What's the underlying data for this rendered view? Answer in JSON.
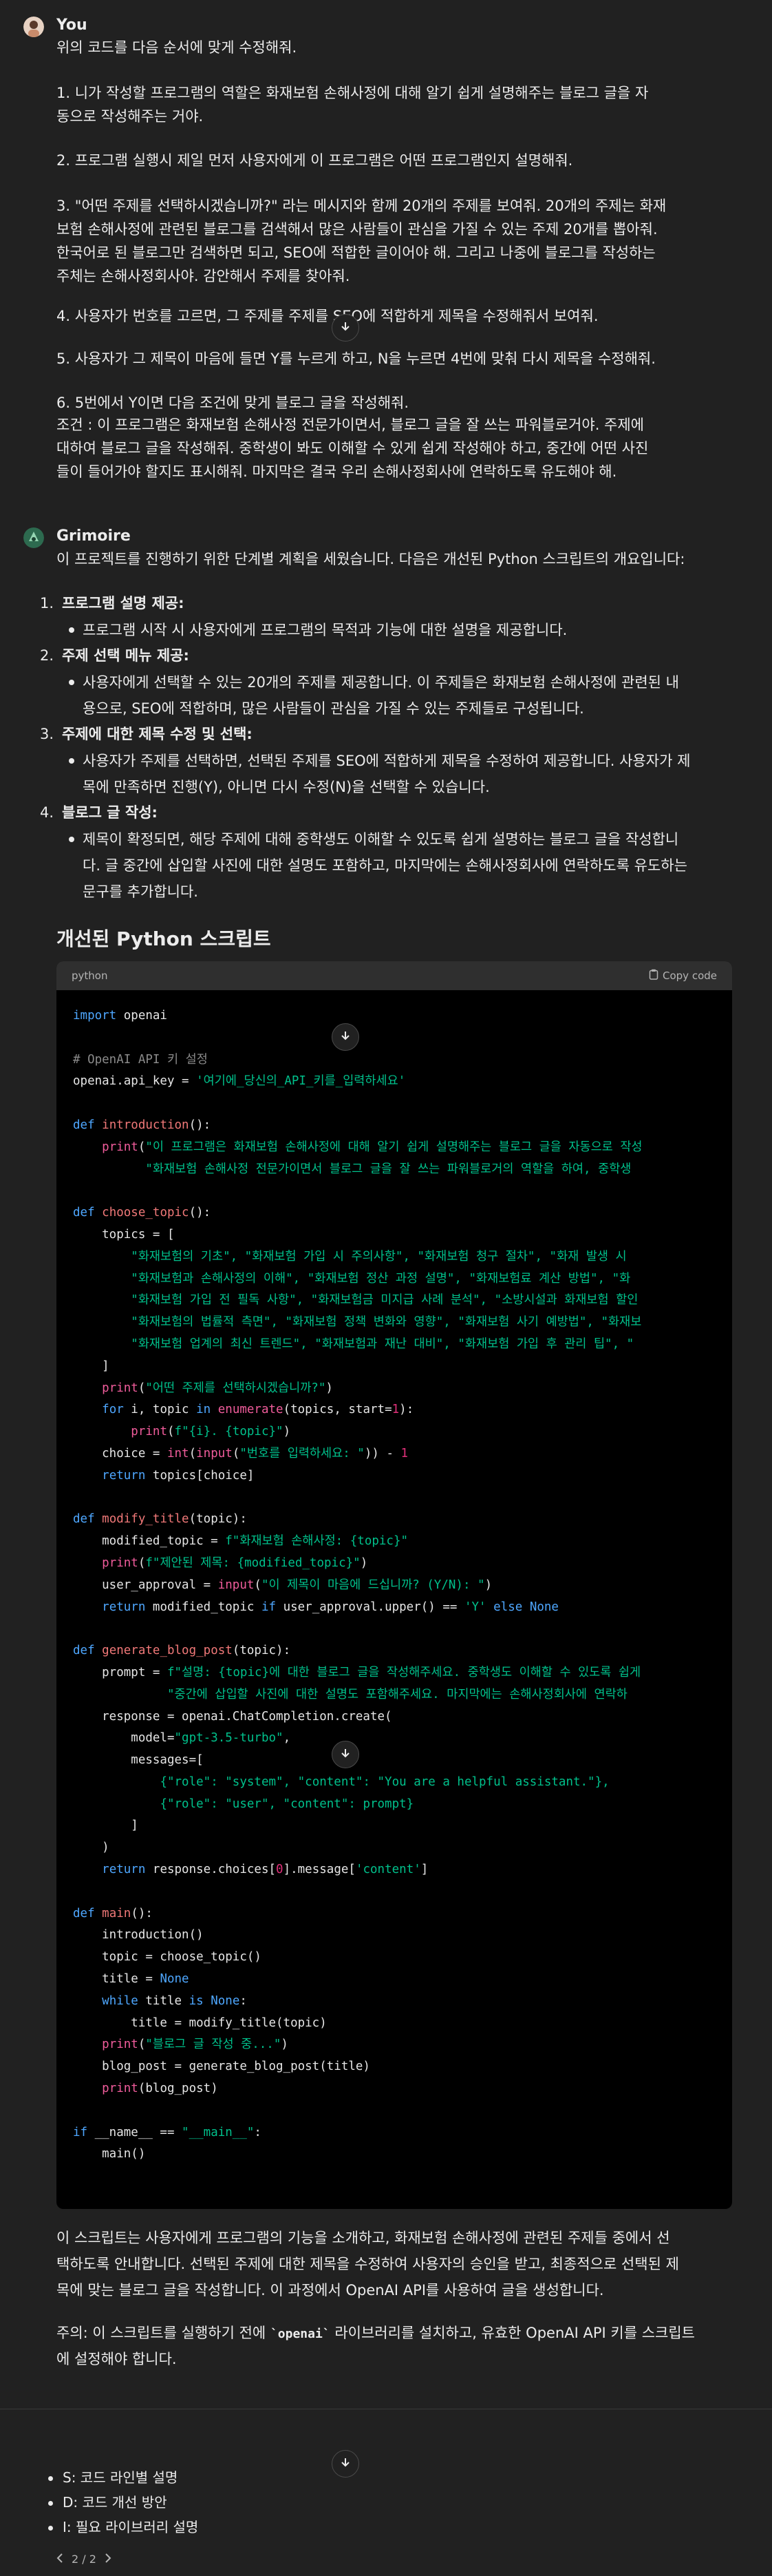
{
  "user": {
    "name": "You",
    "lines": [
      "위의 코드를 다음 순서에 맞게 수정해줘.",
      "1. 니가 작성할 프로그램의 역할은 화재보험 손해사정에 대해 알기 쉽게 설명해주는 블로그 글을 자",
      "동으로 작성해주는 거야.",
      "2. 프로그램 실행시 제일 먼저 사용자에게 이 프로그램은 어떤 프로그램인지 설명해줘.",
      "3. \"어떤 주제를 선택하시겠습니까?\" 라는 메시지와 함께 20개의 주제를 보여줘. 20개의 주제는 화재",
      "보험 손해사정에 관련된 블로그를 검색해서 많은 사람들이 관심을 가질 수 있는 주제 20개를 뽑아줘.",
      "한국어로 된 블로그만 검색하면 되고, SEO에 적합한 글이어야 해. 그리고 나중에 블로그를 작성하는",
      "주체는 손해사정회사야. 감안해서 주제를 찾아줘.",
      "4. 사용자가 번호를 고르면, 그 주제를 주제를 SEO에 적합하게 제목을 수정해줘서 보여줘.",
      "5. 사용자가 그 제목이 마음에 들면 Y를 누르게 하고, N을 누르면 4번에 맞춰 다시 제목을 수정해줘.",
      "6. 5번에서 Y이면 다음 조건에 맞게 블로그 글을 작성해줘.",
      "조건 : 이 프로그램은 화재보험 손해사정 전문가이면서, 블로그 글을 잘 쓰는 파워블로거야. 주제에",
      "대하여 블로그 글을 작성해줘. 중학생이 봐도 이해할 수 있게 쉽게 작성해야 하고, 중간에 어떤 사진",
      "들이 들어가야 할지도 표시해줘. 마지막은 결국 우리 손해사정회사에 연락하도록 유도해야 해."
    ]
  },
  "assistant": {
    "name": "Grimoire",
    "intro": "이 프로젝트를 진행하기 위한 단계별 계획을 세웠습니다. 다음은 개선된 Python 스크립트의 개요입니다:",
    "steps": [
      {
        "num": "1.",
        "title": "프로그램 설명 제공:",
        "lines": [
          "프로그램 시작 시 사용자에게 프로그램의 목적과 기능에 대한 설명을 제공합니다."
        ]
      },
      {
        "num": "2.",
        "title": "주제 선택 메뉴 제공:",
        "lines": [
          "사용자에게 선택할 수 있는 20개의 주제를 제공합니다. 이 주제들은 화재보험 손해사정에 관련된 내",
          "용으로, SEO에 적합하며, 많은 사람들이 관심을 가질 수 있는 주제들로 구성됩니다."
        ]
      },
      {
        "num": "3.",
        "title": "주제에 대한 제목 수정 및 선택:",
        "lines": [
          "사용자가 주제를 선택하면, 선택된 주제를 SEO에 적합하게 제목을 수정하여 제공합니다. 사용자가 제",
          "목에 만족하면 진행(Y), 아니면 다시 수정(N)을 선택할 수 있습니다."
        ]
      },
      {
        "num": "4.",
        "title": "블로그 글 작성:",
        "lines": [
          "제목이 확정되면, 해당 주제에 대해 중학생도 이해할 수 있도록 쉽게 설명하는 블로그 글을 작성합니",
          "다. 글 중간에 삽입할 사진에 대한 설명도 포함하고, 마지막에는 손해사정회사에 연락하도록 유도하는",
          "문구를 추가합니다."
        ]
      }
    ],
    "heading": "개선된 Python 스크립트",
    "code": {
      "language": "python",
      "copy_label": "Copy code",
      "line_texts": {
        "key_line": "openai.api_key = '여기에_당신의_API_키를_입력하세요'",
        "comment": "# OpenAI API 키 설정",
        "intro_print1": "\"이 프로그램은 화재보험 손해사정에 대해 알기 쉽게 설명해주는 블로그 글을 자동으로 작성",
        "intro_print2": "\"화재보험 손해사정 전문가이면서 블로그 글을 잘 쓰는 파워블로거의 역할을 하여, 중학생",
        "topics1": "\"화재보험의 기초\", \"화재보험 가입 시 주의사항\", \"화재보험 청구 절차\", \"화재 발생 시",
        "topics2": "\"화재보험과 손해사정의 이해\", \"화재보험 정산 과정 설명\", \"화재보험료 계산 방법\", \"화",
        "topics3": "\"화재보험 가입 전 필독 사항\", \"화재보험금 미지급 사례 분석\", \"소방시설과 화재보험 할인",
        "topics4": "\"화재보험의 법률적 측면\", \"화재보험 정책 변화와 영향\", \"화재보험 사기 예방법\", \"화재보",
        "topics5": "\"화재보험 업계의 최신 트렌드\", \"화재보험과 재난 대비\", \"화재보험 가입 후 관리 팁\", \"",
        "choose_print": "\"어떤 주제를 선택하시겠습니까?\"",
        "fstr_topic": "f\"{i}. {topic}\"",
        "input_num": "\"번호를 입력하세요: \"",
        "mod_topic": "f\"화재보험 손해사정: {topic}\"",
        "mod_print": "f\"제안된 제목: {modified_topic}\"",
        "approval": "\"이 제목이 마음에 드십니까? (Y/N): \"",
        "prompt1": "f\"설명: {topic}에 대한 블로그 글을 작성해주세요. 중학생도 이해할 수 있도록 쉽게",
        "prompt2": "\"중간에 삽입할 사진에 대한 설명도 포함해주세요. 마지막에는 손해사정회사에 연락하",
        "model": "\"gpt-3.5-turbo\"",
        "sys_msg": "{\"role\": \"system\", \"content\": \"You are a helpful assistant.\"},",
        "user_msg": "{\"role\": \"user\", \"content\": prompt}",
        "writing": "\"블로그 글 작성 중...\"",
        "main_str": "\"__main__\""
      }
    },
    "summary_lines": [
      "이 스크립트는 사용자에게 프로그램의 기능을 소개하고, 화재보험 손해사정에 관련된 주제들 중에서 선",
      "택하도록 안내합니다. 선택된 주제에 대한 제목을 수정하여 사용자의 승인을 받고, 최종적으로 선택된 제",
      "목에 맞는 블로그 글을 작성합니다. 이 과정에서 OpenAI API를 사용하여 글을 생성합니다."
    ],
    "note_lines": {
      "part1": "주의: 이 스크립트를 실행하기 전에 ",
      "lib": "`openai`",
      "part2": " 라이브러리를 설치하고, 유효한 OpenAI API 키를 스크립트",
      "line2": "에 설정해야 합니다."
    }
  },
  "suggestions": [
    "S: 코드 라인별 설명",
    "D: 코드 개선 방안",
    "I: 필요 라이브러리 설명"
  ],
  "pager": {
    "label": "2 / 2"
  }
}
